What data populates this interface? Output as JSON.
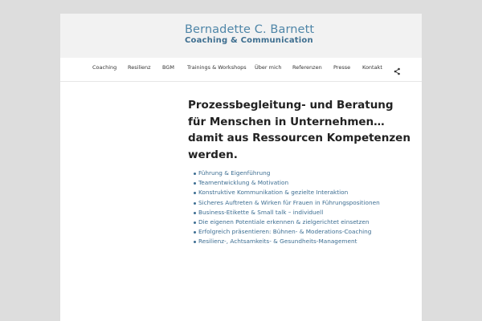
{
  "header": {
    "brand_name": "Bernadette C. Barnett",
    "brand_tagline": "Coaching & Communication"
  },
  "nav": {
    "items": [
      {
        "label": "Coaching"
      },
      {
        "label": "Resilienz"
      },
      {
        "label": "BGM"
      },
      {
        "label": "Trainings & Workshops"
      },
      {
        "label": "Über mich"
      },
      {
        "label": "Referenzen"
      },
      {
        "label": "Presse"
      },
      {
        "label": "Kontakt"
      }
    ],
    "share_icon": "share-icon"
  },
  "main": {
    "headline_lines": [
      "Prozessbegleitung- und Beratung",
      "für Menschen in Unternehmen…",
      "damit aus Ressourcen Kompetenzen",
      "werden."
    ],
    "services": [
      "Führung & Eigenführung",
      "Teamentwicklung & Motivation",
      "Konstruktive Kommunikation & gezielte Interaktion",
      "Sicheres Auftreten & Wirken für Frauen in Führungspositionen",
      "Business-Etikette & Small talk – individuell",
      "Die eigenen Potentiale erkennen & zielgerichtet einsetzen",
      "Erfolgreich präsentieren: Bühnen- & Moderations-Coaching",
      "Resilienz-, Achtsamkeits- & Gesundheits-Management"
    ]
  },
  "colors": {
    "background": "#dddddd",
    "header_bg": "#f2f2f2",
    "brand": "#4f86a8",
    "link": "#3d6e92",
    "text": "#222222"
  }
}
